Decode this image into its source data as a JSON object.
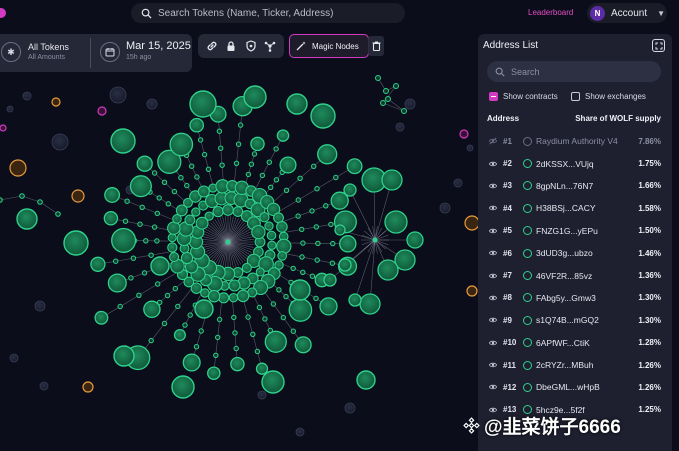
{
  "search": {
    "placeholder": "Search Tokens (Name, Ticker, Address)"
  },
  "header": {
    "leaderboard_label": "Leaderboard",
    "account_label": "Account",
    "avatar_letter": "N"
  },
  "token_selector": {
    "title": "All Tokens",
    "subtitle": "All Amounts",
    "date": "Mar 15, 2025",
    "date_sub": "15h ago"
  },
  "toolbar": {
    "icons": [
      "link-icon",
      "lock-icon",
      "shield-icon",
      "nodes-icon"
    ],
    "magic_label": "Magic Nodes",
    "trash_icon": "trash-icon"
  },
  "address_list": {
    "title": "Address List",
    "search_placeholder": "Search",
    "show_contracts_label": "Show contracts",
    "show_contracts_checked": true,
    "show_exchanges_label": "Show exchanges",
    "show_exchanges_checked": false,
    "col_address": "Address",
    "col_share": "Share of WOLF supply",
    "rows": [
      {
        "rank": "#1",
        "address": "Raydium Authority V4",
        "share": "7.86%",
        "hidden": true
      },
      {
        "rank": "#2",
        "address": "2dKSSX...VUjq",
        "share": "1.75%"
      },
      {
        "rank": "#3",
        "address": "8gpNLn...76N7",
        "share": "1.66%"
      },
      {
        "rank": "#4",
        "address": "H38BSj...CACY",
        "share": "1.58%"
      },
      {
        "rank": "#5",
        "address": "FNZG1G...yEPu",
        "share": "1.50%"
      },
      {
        "rank": "#6",
        "address": "3dUD3g...ubzo",
        "share": "1.46%"
      },
      {
        "rank": "#7",
        "address": "46VF2R...85vz",
        "share": "1.36%"
      },
      {
        "rank": "#8",
        "address": "FAbg5y...Gmw3",
        "share": "1.30%"
      },
      {
        "rank": "#9",
        "address": "s1Q74B...mGQ2",
        "share": "1.30%"
      },
      {
        "rank": "#10",
        "address": "6APfWF...CtiK",
        "share": "1.28%"
      },
      {
        "rank": "#11",
        "address": "2cRYZr...MBuh",
        "share": "1.26%"
      },
      {
        "rank": "#12",
        "address": "DbeGML...wHpB",
        "share": "1.26%"
      },
      {
        "rank": "#13",
        "address": "5hcz9e...5f2f",
        "share": "1.25%"
      }
    ]
  },
  "watermark": {
    "text": "@韭菜饼子6666"
  },
  "colors": {
    "accent": "#d23ac2",
    "node_green": "#2fd18c",
    "node_orange": "#e89a3c",
    "background": "#0b0d1a"
  }
}
